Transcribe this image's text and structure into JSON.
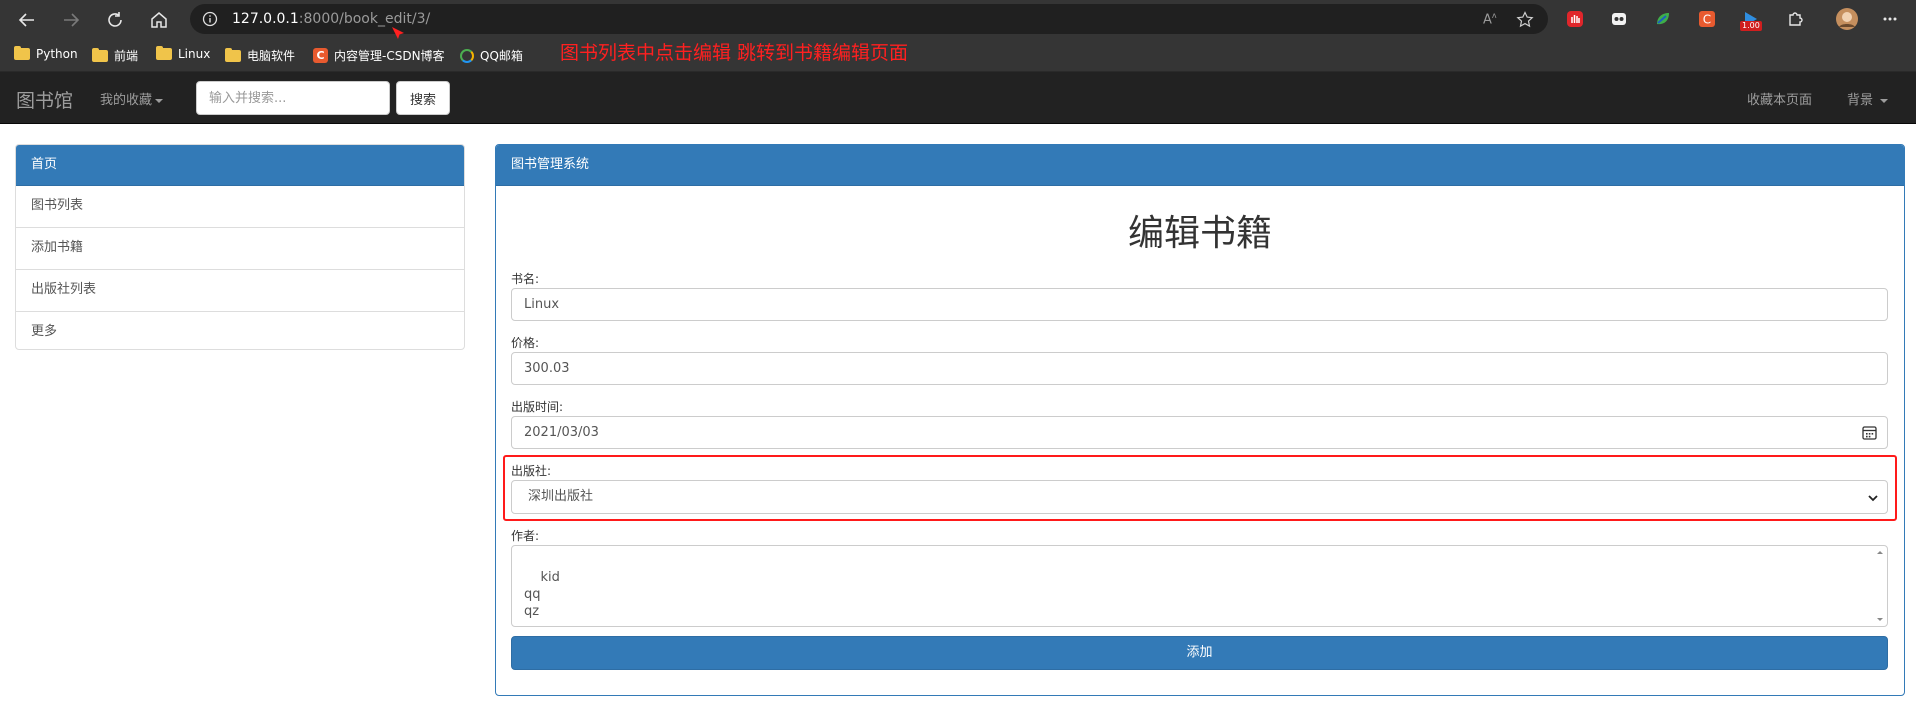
{
  "browser": {
    "url_host": "127.0.0.1",
    "url_rest": ":8000/book_edit/3/",
    "badge": "1.00",
    "bookmarks": [
      "Python",
      "前端",
      "Linux",
      "电脑软件",
      "内容管理-CSDN博客",
      "QQ邮箱"
    ],
    "annotation": "图书列表中点击编辑 跳转到书籍编辑页面"
  },
  "navbar": {
    "brand": "图书馆",
    "favorites": "我的收藏",
    "search_placeholder": "输入并搜索...",
    "search_button": "搜索",
    "bookmark_page": "收藏本页面",
    "background": "背景"
  },
  "sidebar": {
    "heading": "首页",
    "items": [
      "图书列表",
      "添加书籍",
      "出版社列表",
      "更多"
    ]
  },
  "main": {
    "heading": "图书管理系统",
    "title": "编辑书籍",
    "fields": {
      "name_label": "书名:",
      "name_value": "Linux",
      "price_label": "价格:",
      "price_value": "300.03",
      "date_label": "出版时间:",
      "date_value": "2021/03/03",
      "publisher_label": "出版社:",
      "publisher_value": "深圳出版社",
      "author_label": "作者:",
      "author_value": "kid\nqq\nqz"
    },
    "submit": "添加"
  },
  "colors": {
    "primary": "#337ab7",
    "navbar_bg": "#222222",
    "chrome_bg": "#353535",
    "annotation": "#ff2020"
  }
}
